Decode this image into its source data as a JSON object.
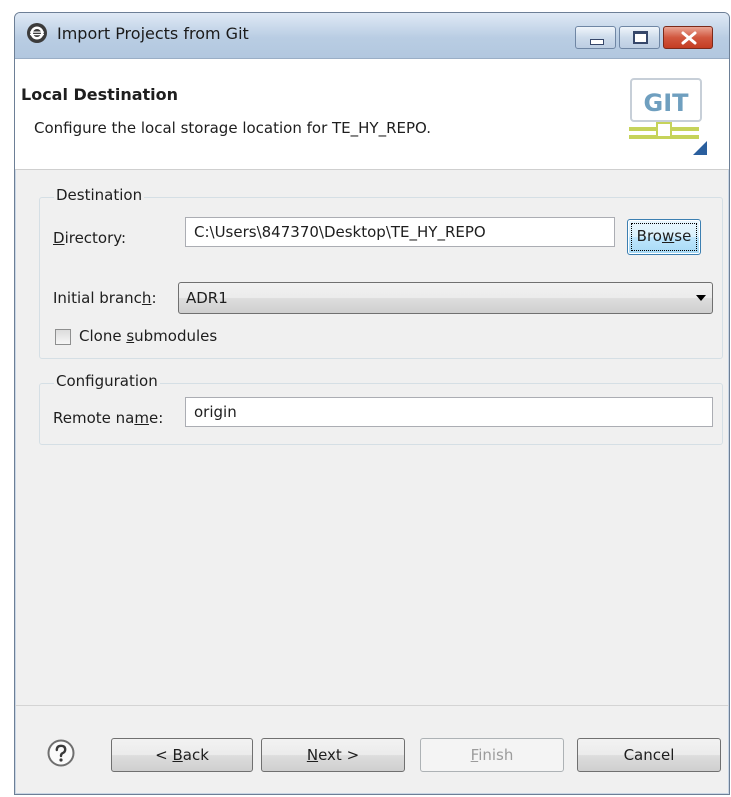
{
  "window": {
    "title": "Import Projects from Git"
  },
  "header": {
    "title": "Local Destination",
    "description": "Configure the local storage location for TE_HY_REPO.",
    "logo_text": "GIT"
  },
  "destination": {
    "legend": "Destination",
    "directory_label_pre": "",
    "directory_label_mnemonic": "D",
    "directory_label_post": "irectory:",
    "directory_value": "C:\\Users\\847370\\Desktop\\TE_HY_REPO",
    "browse_pre": "Bro",
    "browse_mnemonic": "w",
    "browse_post": "se",
    "branch_label_pre": "Initial branc",
    "branch_label_mnemonic": "h",
    "branch_label_post": ":",
    "branch_value": "ADR1",
    "clone_pre": "Clone ",
    "clone_mnemonic": "s",
    "clone_post": "ubmodules",
    "clone_checked": false
  },
  "configuration": {
    "legend": "Configuration",
    "remote_label_pre": "Remote na",
    "remote_label_mnemonic": "m",
    "remote_label_post": "e:",
    "remote_value": "origin"
  },
  "footer": {
    "back_pre": "< ",
    "back_mnemonic": "B",
    "back_post": "ack",
    "next_pre": "",
    "next_mnemonic": "N",
    "next_post": "ext >",
    "finish_pre": "",
    "finish_mnemonic": "F",
    "finish_post": "inish",
    "cancel": "Cancel"
  },
  "colors": {
    "accent": "#3c7fb1",
    "titlebar": "#b9cde3",
    "close": "#c43d22"
  }
}
